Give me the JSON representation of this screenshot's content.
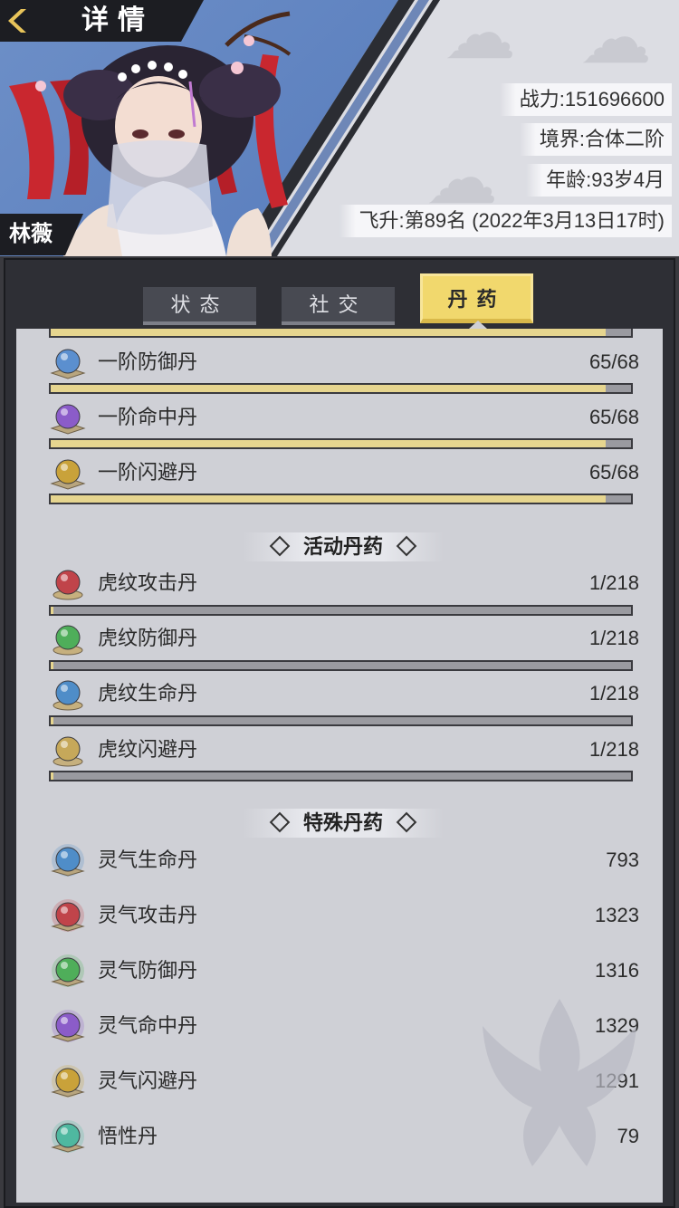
{
  "header": {
    "title": "详情",
    "character_name": "林薇",
    "stats": [
      {
        "label": "战力:",
        "value": "151696600"
      },
      {
        "label": "境界:",
        "value": "合体二阶"
      },
      {
        "label": "年龄:",
        "value": "93岁4月"
      },
      {
        "label": "飞升:",
        "value": "第89名 (2022年3月13日17时)"
      }
    ]
  },
  "tabs": [
    {
      "label": "状态",
      "active": false
    },
    {
      "label": "社交",
      "active": false
    },
    {
      "label": "丹药",
      "active": true
    }
  ],
  "basic_pills": [
    {
      "name": "一阶防御丹",
      "value": "65/68",
      "progress": 0.956,
      "color": "#5b8fcf",
      "icon": "blue-pill-icon"
    },
    {
      "name": "一阶命中丹",
      "value": "65/68",
      "progress": 0.956,
      "color": "#8b5cc9",
      "icon": "purple-pill-icon"
    },
    {
      "name": "一阶闪避丹",
      "value": "65/68",
      "progress": 0.956,
      "color": "#c9a23a",
      "icon": "gold-pill-icon"
    }
  ],
  "top_bar_progress": 0.956,
  "event_section_title": "活动丹药",
  "event_pills": [
    {
      "name": "虎纹攻击丹",
      "value": "1/218",
      "progress": 0.0046,
      "color": "#c0444a",
      "icon": "red-tiger-pill-icon"
    },
    {
      "name": "虎纹防御丹",
      "value": "1/218",
      "progress": 0.0046,
      "color": "#4fae5a",
      "icon": "green-tiger-pill-icon"
    },
    {
      "name": "虎纹生命丹",
      "value": "1/218",
      "progress": 0.0046,
      "color": "#4f8dc8",
      "icon": "blue-tiger-pill-icon"
    },
    {
      "name": "虎纹闪避丹",
      "value": "1/218",
      "progress": 0.0046,
      "color": "#c6a85a",
      "icon": "gold-tiger-pill-icon"
    }
  ],
  "special_section_title": "特殊丹药",
  "special_pills": [
    {
      "name": "灵气生命丹",
      "value": "793",
      "color": "#4f8dc8",
      "icon": "blue-spirit-pill-icon"
    },
    {
      "name": "灵气攻击丹",
      "value": "1323",
      "color": "#c0444a",
      "icon": "red-spirit-pill-icon"
    },
    {
      "name": "灵气防御丹",
      "value": "1316",
      "color": "#4fae5a",
      "icon": "green-spirit-pill-icon"
    },
    {
      "name": "灵气命中丹",
      "value": "1329",
      "color": "#8b5cc9",
      "icon": "purple-spirit-pill-icon"
    },
    {
      "name": "灵气闪避丹",
      "value": "1291",
      "color": "#c9a23a",
      "icon": "gold-spirit-pill-icon"
    },
    {
      "name": "悟性丹",
      "value": "79",
      "color": "#4fb8a0",
      "icon": "teal-pill-icon"
    }
  ]
}
